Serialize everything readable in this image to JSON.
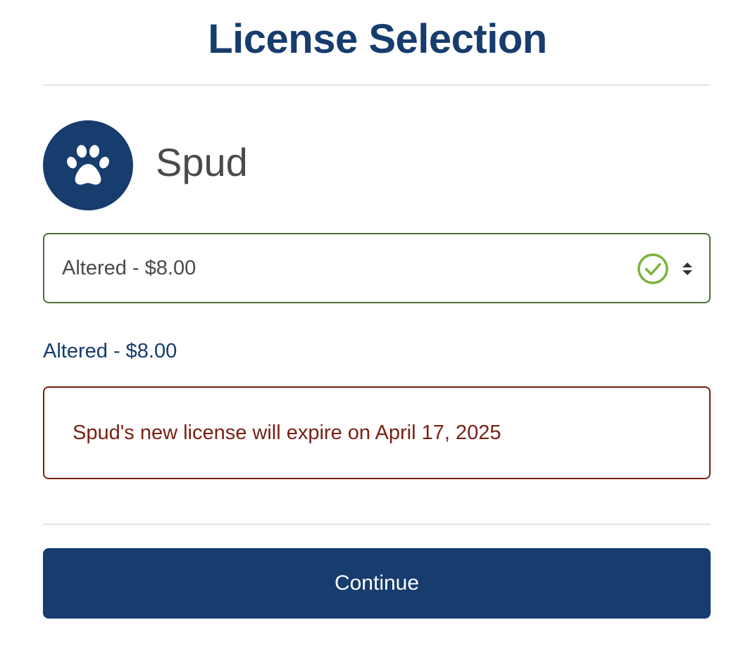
{
  "header": {
    "title": "License Selection"
  },
  "pet": {
    "name": "Spud",
    "avatar_icon": "paw-icon"
  },
  "license_select": {
    "value": "Altered - $8.00",
    "status_icon": "check-circle-icon",
    "dropdown_icon": "sort-arrows-icon"
  },
  "selected_summary": "Altered - $8.00",
  "expiry_notice": {
    "text": "Spud's new license will expire on April 17, 2025"
  },
  "actions": {
    "continue_label": "Continue"
  },
  "colors": {
    "primary": "#173c6e",
    "valid_border": "#4e6e3e",
    "valid_check": "#7cb33c",
    "notice": "#7a1f14",
    "divider": "#e4e4e4"
  }
}
